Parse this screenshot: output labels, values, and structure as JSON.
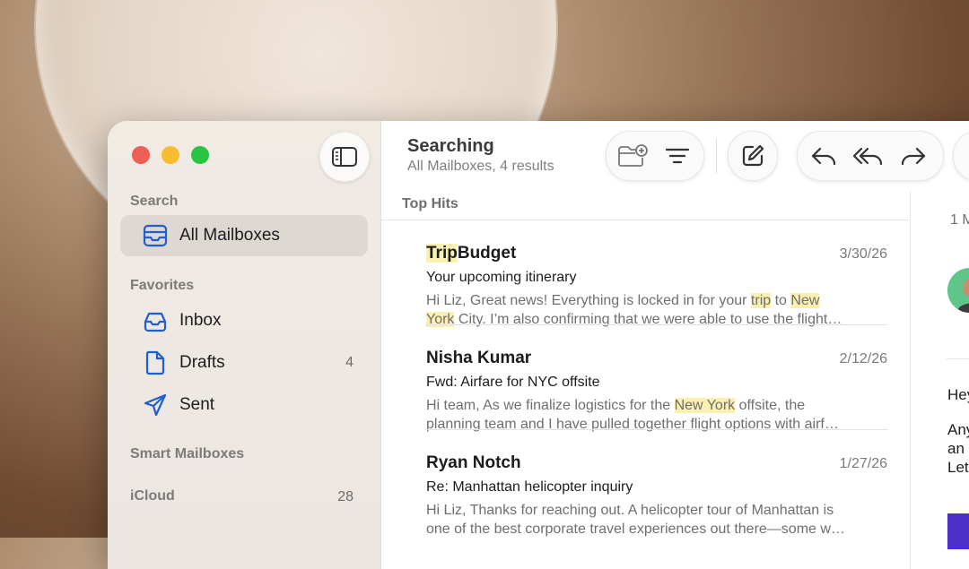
{
  "sidebar": {
    "sections": {
      "search": "Search",
      "favorites": "Favorites",
      "smart_mailboxes": "Smart Mailboxes",
      "icloud": "iCloud"
    },
    "all_mailboxes": {
      "label": "All Mailboxes",
      "icon": "tray-stack-icon"
    },
    "favorites": [
      {
        "label": "Inbox",
        "icon": "inbox-icon",
        "count": ""
      },
      {
        "label": "Drafts",
        "icon": "document-icon",
        "count": "4"
      },
      {
        "label": "Sent",
        "icon": "paper-plane-icon",
        "count": ""
      }
    ],
    "icloud_count": "28"
  },
  "header": {
    "title": "Searching",
    "subtitle": "All Mailboxes, 4 results"
  },
  "list": {
    "section_title": "Top Hits",
    "messages": [
      {
        "sender_highlight": "Trip",
        "sender_rest": "Budget",
        "date": "3/30/26",
        "subject": "Your upcoming itinerary",
        "line1_a": "Hi Liz, Great news! Everything is locked in for your ",
        "line1_hl1": "trip",
        "line1_b": " to ",
        "line1_hl2": "New",
        "line2_hl": "York",
        "line2_rest": " City. I’m also confirming that we were able to use the flight…"
      },
      {
        "sender": "Nisha Kumar",
        "date": "2/12/26",
        "subject": "Fwd: Airfare for NYC offsite",
        "line1_a": "Hi team, As we finalize logistics for the ",
        "line1_hl": "New York",
        "line1_b": " offsite, the",
        "line2": "planning team and I have pulled together flight options with airf…"
      },
      {
        "sender": "Ryan Notch",
        "date": "1/27/26",
        "subject": "Re: Manhattan helicopter inquiry",
        "line1": "Hi Liz, Thanks for reaching out. A helicopter tour of Manhattan is",
        "line2": "one of the best corporate travel experiences out there—some w…"
      }
    ]
  },
  "reading": {
    "date_fragment": "1 M",
    "text1": "Hey",
    "text2": "Any",
    "text3": "an",
    "text4": "Let"
  },
  "colors": {
    "accent": "#1f5fd1",
    "highlight": "#fbf0b0",
    "close": "#ed5e57",
    "minimize": "#f5bd2f",
    "zoom": "#29c440"
  }
}
